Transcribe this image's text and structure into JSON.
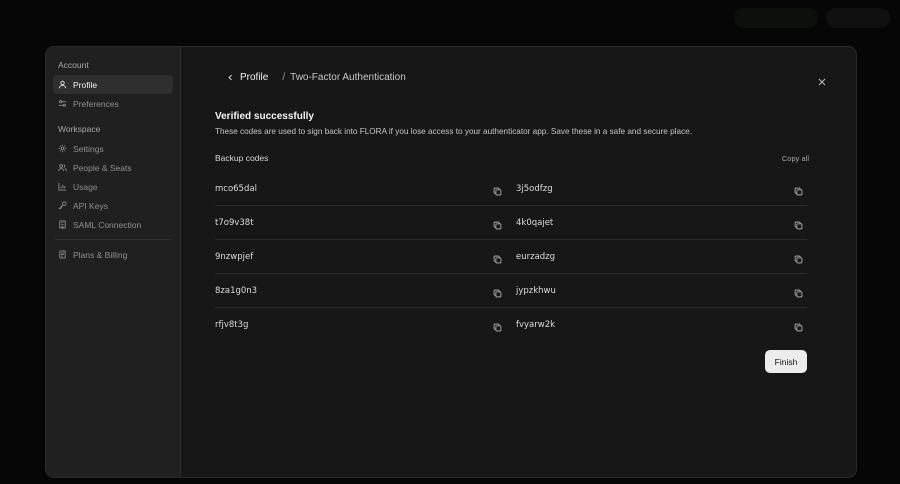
{
  "sidebar": {
    "account_label": "Account",
    "workspace_label": "Workspace",
    "account_items": [
      {
        "label": "Profile",
        "icon": "user-icon",
        "active": true
      },
      {
        "label": "Preferences",
        "icon": "sliders-icon",
        "active": false
      }
    ],
    "workspace_items": [
      {
        "label": "Settings",
        "icon": "gear-icon"
      },
      {
        "label": "People & Seats",
        "icon": "users-icon"
      },
      {
        "label": "Usage",
        "icon": "bar-chart-icon"
      },
      {
        "label": "API Keys",
        "icon": "key-icon"
      },
      {
        "label": "SAML Connection",
        "icon": "building-icon"
      }
    ],
    "billing_item": {
      "label": "Plans & Billing",
      "icon": "receipt-icon"
    }
  },
  "breadcrumb": {
    "back_label": "Profile",
    "separator": "/",
    "current": "Two-Factor Authentication"
  },
  "main": {
    "title": "Verified successfully",
    "description": "These codes are used to sign back into FLORA if you lose access to your authenticator app. Save these in a safe and secure place.",
    "codes_label": "Backup codes",
    "copy_all_label": "Copy all",
    "codes": [
      [
        "mco65dal",
        "3j5odfzg"
      ],
      [
        "t7o9v38t",
        "4k0qajet"
      ],
      [
        "9nzwpjef",
        "eurzadzg"
      ],
      [
        "8za1g0n3",
        "jypzkhwu"
      ],
      [
        "rfjv8t3g",
        "fvyarw2k"
      ]
    ],
    "finish_label": "Finish"
  },
  "colors": {
    "modal_bg": "#171717",
    "sidebar_bg": "#202020",
    "active_item_bg": "#2f2f2f",
    "button_bg": "#ececec"
  }
}
